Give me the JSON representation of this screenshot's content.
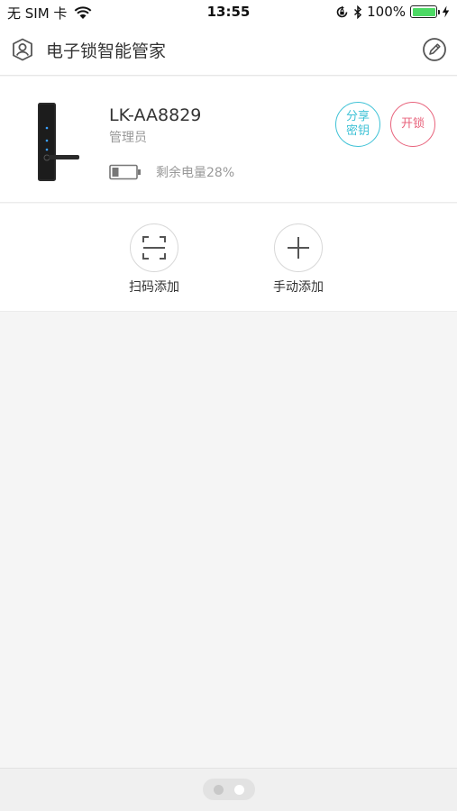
{
  "status_bar": {
    "carrier": "无 SIM 卡",
    "time": "13:55",
    "battery_percent": "100%",
    "battery_level": 1.0
  },
  "nav": {
    "title": "电子锁智能管家",
    "left_icon": "user-icon",
    "right_icon": "edit-icon"
  },
  "device": {
    "name": "LK-AA8829",
    "role": "管理员",
    "battery_text": "剩余电量28%",
    "battery_level": 0.28,
    "share_label": "分享\n密钥",
    "unlock_label": "开锁"
  },
  "actions": {
    "scan_label": "扫码添加",
    "manual_label": "手动添加"
  },
  "colors": {
    "share": "#3fc2d6",
    "unlock": "#e8637c",
    "status_battery": "#4cd964"
  }
}
